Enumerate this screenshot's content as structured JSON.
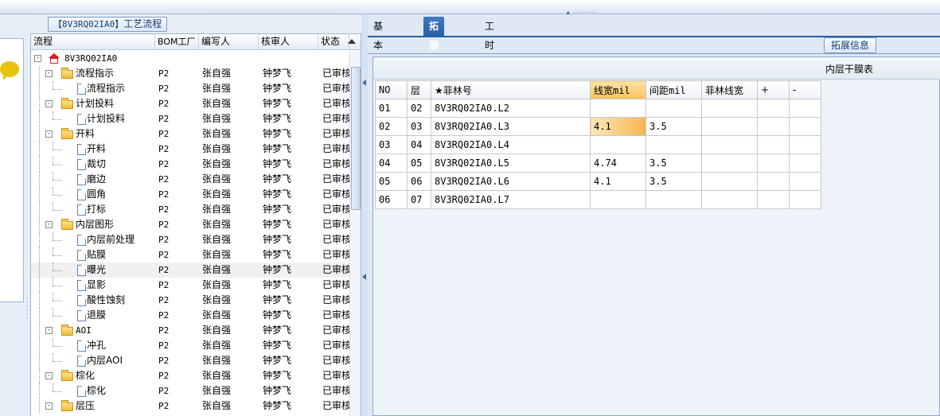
{
  "left_panel": {
    "title_code": "【8V3RQ02IA0】",
    "title_text": "工艺流程"
  },
  "tree": {
    "columns": [
      "流程",
      "BOM工厂",
      "编写人",
      "核审人",
      "状态"
    ],
    "rows": [
      {
        "label": "8V3RQ02IA0",
        "level": 0,
        "icon": "home-icon",
        "bom": "",
        "writer": "",
        "reviewer": "",
        "status": "",
        "expander": "-"
      },
      {
        "label": "流程指示",
        "level": 1,
        "icon": "folder-icon",
        "bom": "P2",
        "writer": "张自强",
        "reviewer": "钟梦飞",
        "status": "已审核",
        "expander": "-"
      },
      {
        "label": "流程指示",
        "level": 2,
        "icon": "document-icon",
        "bom": "P2",
        "writer": "张自强",
        "reviewer": "钟梦飞",
        "status": "已审核"
      },
      {
        "label": "计划投料",
        "level": 1,
        "icon": "folder-icon",
        "bom": "P2",
        "writer": "张自强",
        "reviewer": "钟梦飞",
        "status": "已审核",
        "expander": "-"
      },
      {
        "label": "计划投料",
        "level": 2,
        "icon": "document-icon",
        "bom": "P2",
        "writer": "张自强",
        "reviewer": "钟梦飞",
        "status": "已审核"
      },
      {
        "label": "开料",
        "level": 1,
        "icon": "folder-icon",
        "bom": "P2",
        "writer": "张自强",
        "reviewer": "钟梦飞",
        "status": "已审核",
        "expander": "-"
      },
      {
        "label": "开料",
        "level": 2,
        "icon": "document-icon",
        "bom": "P2",
        "writer": "张自强",
        "reviewer": "钟梦飞",
        "status": "已审核"
      },
      {
        "label": "裁切",
        "level": 2,
        "icon": "document-icon",
        "bom": "P2",
        "writer": "张自强",
        "reviewer": "钟梦飞",
        "status": "已审核"
      },
      {
        "label": "磨边",
        "level": 2,
        "icon": "document-icon",
        "bom": "P2",
        "writer": "张自强",
        "reviewer": "钟梦飞",
        "status": "已审核"
      },
      {
        "label": "圆角",
        "level": 2,
        "icon": "document-icon",
        "bom": "P2",
        "writer": "张自强",
        "reviewer": "钟梦飞",
        "status": "已审核"
      },
      {
        "label": "打标",
        "level": 2,
        "icon": "document-icon",
        "bom": "P2",
        "writer": "张自强",
        "reviewer": "钟梦飞",
        "status": "已审核"
      },
      {
        "label": "内层图形",
        "level": 1,
        "icon": "folder-icon",
        "bom": "P2",
        "writer": "张自强",
        "reviewer": "钟梦飞",
        "status": "已审核",
        "expander": "-"
      },
      {
        "label": "内层前处理",
        "level": 2,
        "icon": "document-icon",
        "bom": "P2",
        "writer": "张自强",
        "reviewer": "钟梦飞",
        "status": "已审核"
      },
      {
        "label": "贴膜",
        "level": 2,
        "icon": "document-icon",
        "bom": "P2",
        "writer": "张自强",
        "reviewer": "钟梦飞",
        "status": "已审核"
      },
      {
        "label": "曝光",
        "level": 2,
        "icon": "document-icon",
        "bom": "P2",
        "writer": "张自强",
        "reviewer": "钟梦飞",
        "status": "已审核",
        "selected": true
      },
      {
        "label": "显影",
        "level": 2,
        "icon": "document-icon",
        "bom": "P2",
        "writer": "张自强",
        "reviewer": "钟梦飞",
        "status": "已审核"
      },
      {
        "label": "酸性蚀刻",
        "level": 2,
        "icon": "document-icon",
        "bom": "P2",
        "writer": "张自强",
        "reviewer": "钟梦飞",
        "status": "已审核"
      },
      {
        "label": "退膜",
        "level": 2,
        "icon": "document-icon",
        "bom": "P2",
        "writer": "张自强",
        "reviewer": "钟梦飞",
        "status": "已审核"
      },
      {
        "label": "AOI",
        "level": 1,
        "icon": "folder-icon",
        "bom": "P2",
        "writer": "张自强",
        "reviewer": "钟梦飞",
        "status": "已审核",
        "expander": "-"
      },
      {
        "label": "冲孔",
        "level": 2,
        "icon": "document-icon",
        "bom": "P2",
        "writer": "张自强",
        "reviewer": "钟梦飞",
        "status": "已审核"
      },
      {
        "label": "内层AOI",
        "level": 2,
        "icon": "document-icon",
        "bom": "P2",
        "writer": "张自强",
        "reviewer": "钟梦飞",
        "status": "已审核"
      },
      {
        "label": "棕化",
        "level": 1,
        "icon": "folder-icon",
        "bom": "P2",
        "writer": "张自强",
        "reviewer": "钟梦飞",
        "status": "已审核",
        "expander": "-"
      },
      {
        "label": "棕化",
        "level": 2,
        "icon": "document-icon",
        "bom": "P2",
        "writer": "张自强",
        "reviewer": "钟梦飞",
        "status": "已审核"
      },
      {
        "label": "层压",
        "level": 1,
        "icon": "folder-icon",
        "bom": "P2",
        "writer": "张自强",
        "reviewer": "钟梦飞",
        "status": "已审核",
        "expander": "-"
      }
    ]
  },
  "tabs": [
    {
      "label": "基本信息",
      "active": false
    },
    {
      "label": "拓展信息",
      "active": true
    },
    {
      "label": "工时",
      "active": false
    }
  ],
  "sub_button": "拓展信息",
  "grid": {
    "caption": "内层干膜表",
    "columns": [
      "NO",
      "层",
      "★菲林号",
      "线宽mil",
      "间距mil",
      "菲林线宽",
      "+",
      "-"
    ],
    "highlight_column": 3,
    "rows": [
      [
        "01",
        "02",
        "8V3RQ02IA0.L2",
        "",
        "",
        "",
        "",
        ""
      ],
      [
        "02",
        "03",
        "8V3RQ02IA0.L3",
        "4.1",
        "3.5",
        "",
        "",
        ""
      ],
      [
        "03",
        "04",
        "8V3RQ02IA0.L4",
        "",
        "",
        "",
        "",
        ""
      ],
      [
        "04",
        "05",
        "8V3RQ02IA0.L5",
        "4.74",
        "3.5",
        "",
        "",
        ""
      ],
      [
        "05",
        "06",
        "8V3RQ02IA0.L6",
        "4.1",
        "3.5",
        "",
        "",
        ""
      ],
      [
        "06",
        "07",
        "8V3RQ02IA0.L7",
        "",
        "",
        "",
        "",
        ""
      ]
    ],
    "active_cell": [
      1,
      3
    ]
  },
  "colors": {
    "accent": "#2b5fa8",
    "highlight": "#f8c15c",
    "panel_bg": "#dfe9f5"
  }
}
